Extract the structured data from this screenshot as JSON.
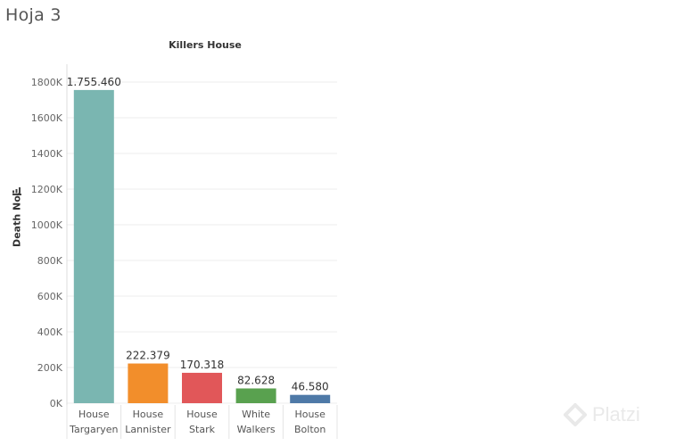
{
  "sheet": {
    "title": "Hoja 3"
  },
  "watermark": {
    "brand": "Platzi"
  },
  "chart_data": {
    "type": "bar",
    "title": "Killers House",
    "ylabel": "Death No.",
    "xlabel": "",
    "ylim": [
      0,
      1900000
    ],
    "yticks": [
      0,
      200000,
      400000,
      600000,
      800000,
      1000000,
      1200000,
      1400000,
      1600000,
      1800000
    ],
    "ytick_labels": [
      "0K",
      "200K",
      "400K",
      "600K",
      "800K",
      "1000K",
      "1200K",
      "1400K",
      "1600K",
      "1800K"
    ],
    "grid": true,
    "categories": [
      [
        "House",
        "Targaryen"
      ],
      [
        "House",
        "Lannister"
      ],
      [
        "House",
        "Stark"
      ],
      [
        "White",
        "Walkers"
      ],
      [
        "House",
        "Bolton"
      ]
    ],
    "values": [
      1755460,
      222379,
      170318,
      82628,
      46580
    ],
    "data_labels": [
      "1.755.460",
      "222.379",
      "170.318",
      "82.628",
      "46.580"
    ],
    "colors": [
      "#7ab6b1",
      "#f28e2b",
      "#e15759",
      "#59a14f",
      "#4e79a7"
    ]
  }
}
